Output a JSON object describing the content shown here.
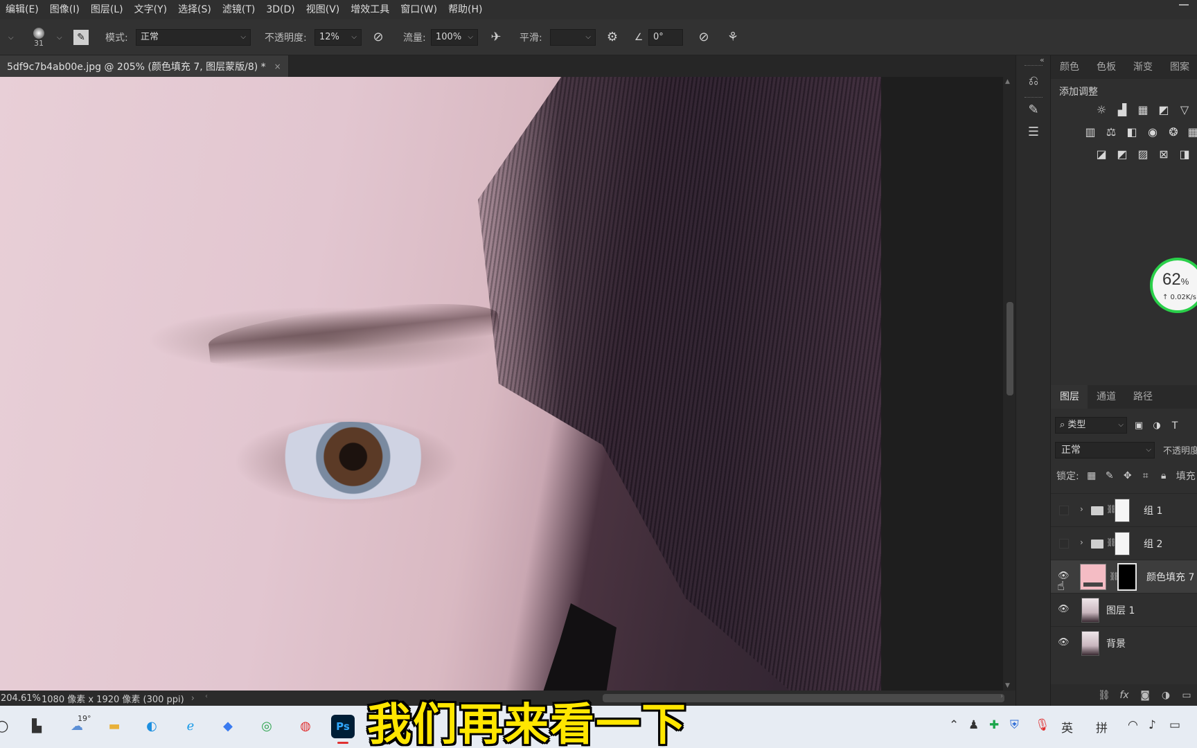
{
  "menubar": {
    "items": [
      "编辑(E)",
      "图像(I)",
      "图层(L)",
      "文字(Y)",
      "选择(S)",
      "滤镜(T)",
      "3D(D)",
      "视图(V)",
      "增效工具",
      "窗口(W)",
      "帮助(H)"
    ]
  },
  "options": {
    "brush_size": "31",
    "mode_label": "模式:",
    "mode_value": "正常",
    "opacity_label": "不透明度:",
    "opacity_value": "12%",
    "flow_label": "流量:",
    "flow_value": "100%",
    "smooth_label": "平滑:",
    "smooth_value": "",
    "angle_value": "0°"
  },
  "document": {
    "tab_title": "5df9c7b4ab00e.jpg @ 205% (颜色填充 7, 图层蒙版/8) *",
    "close_glyph": "×"
  },
  "status": {
    "zoom": "204.61%",
    "info": "1080 像素 x 1920 像素 (300 ppi)",
    "arrow": "›"
  },
  "panels": {
    "top_tabs": [
      "颜色",
      "色板",
      "渐变",
      "图案"
    ],
    "adjust_title": "添加调整",
    "layer_tabs": [
      "图层",
      "通道",
      "路径"
    ],
    "filter_label": "类型",
    "blend_mode": "正常",
    "opacity_label": "不透明度",
    "lock_label": "锁定:",
    "fill_label": "填充"
  },
  "layers": [
    {
      "name": "组 1",
      "visible": false,
      "type": "group"
    },
    {
      "name": "组 2",
      "visible": false,
      "type": "group"
    },
    {
      "name": "颜色填充 7",
      "visible": true,
      "type": "fill",
      "selected": true,
      "fill_color": "#f4bcc4"
    },
    {
      "name": "图层 1",
      "visible": true,
      "type": "pixel"
    },
    {
      "name": "背景",
      "visible": true,
      "type": "pixel"
    }
  ],
  "net_widget": {
    "percent": "62",
    "unit": "%",
    "speed": "↑ 0.02K/s"
  },
  "taskbar": {
    "weather_temp": "19°",
    "ime_lang": "英",
    "ime_mode": "拼"
  },
  "subtitle": "我们再来看一下"
}
